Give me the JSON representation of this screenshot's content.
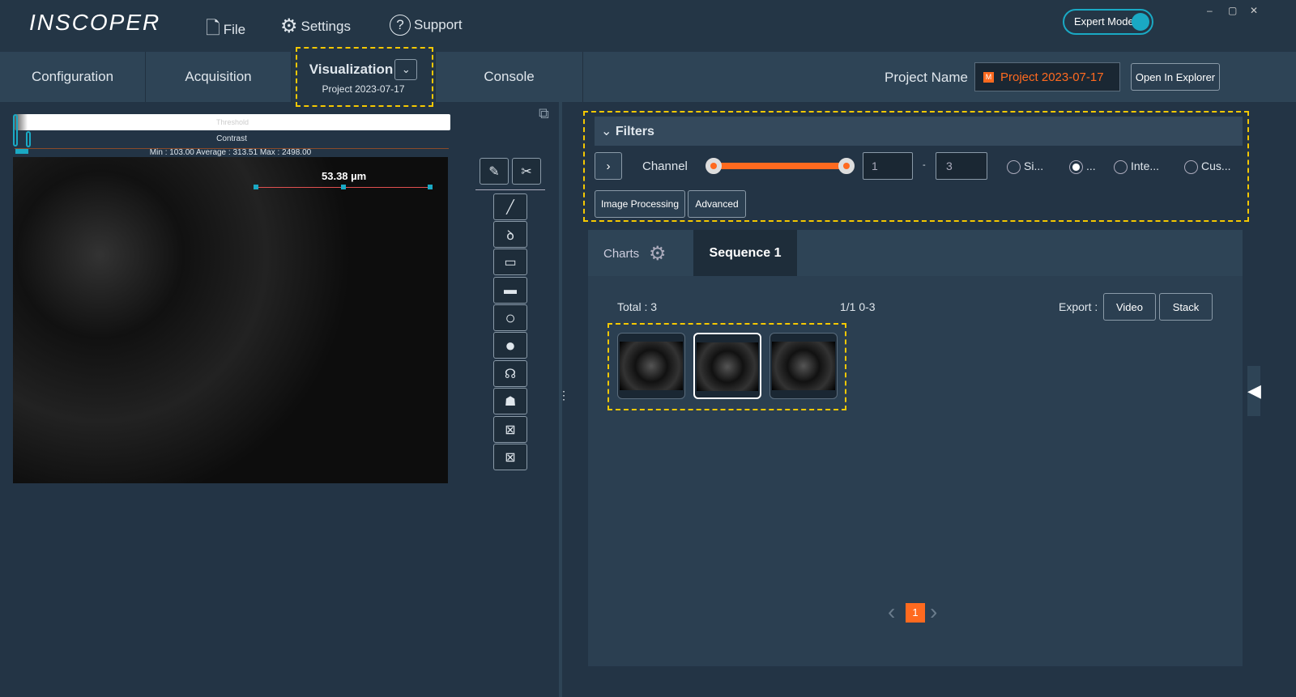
{
  "app": {
    "logo": "INSCOPER",
    "menu": {
      "file": "File",
      "settings": "Settings",
      "support": "Support"
    },
    "expert_mode": "Expert Mode",
    "expert_mode_on": true,
    "window": {
      "minimize": "–",
      "maximize": "▢",
      "close": "✕"
    }
  },
  "tabs": [
    {
      "label": "Configuration"
    },
    {
      "label": "Acquisition"
    },
    {
      "label": "Visualization",
      "sub": "Project 2023-07-17",
      "active": true
    },
    {
      "label": "Console"
    }
  ],
  "project": {
    "label": "Project Name",
    "value": "Project 2023-07-17",
    "badge": "M",
    "open_button": "Open In Explorer"
  },
  "viewer": {
    "threshold": "Threshold",
    "contrast": "Contrast",
    "stats": "Min : 103.00 Average : 313.51 Max : 2498.00",
    "measure": "53.38 µm"
  },
  "tools": [
    "pencil-icon",
    "scissors-icon",
    "line-icon",
    "freehand-icon",
    "rectangle-icon",
    "filled-rectangle-icon",
    "circle-icon",
    "filled-circle-icon",
    "polygon-icon",
    "filled-polygon-icon",
    "roi-cross-icon",
    "roi-cross-icon-2"
  ],
  "filters": {
    "title": "Filters",
    "channel": "Channel",
    "from": "1",
    "to": "3",
    "separator": "-",
    "options": [
      "Si...",
      "...",
      "Inte...",
      "Cus..."
    ],
    "selected": 1,
    "buttons": [
      "Image Processing",
      "Advanced"
    ]
  },
  "panel": {
    "tabs": [
      "Charts",
      "Sequence 1"
    ],
    "total": "Total : 3",
    "range": "1/1 0-3",
    "export": "Export :",
    "video": "Video",
    "stack": "Stack",
    "page": "1",
    "selected_thumb": 1
  },
  "colors": {
    "accent": "#ff6a1f",
    "cyan": "#1aa9c4",
    "highlight": "#f5c800"
  }
}
